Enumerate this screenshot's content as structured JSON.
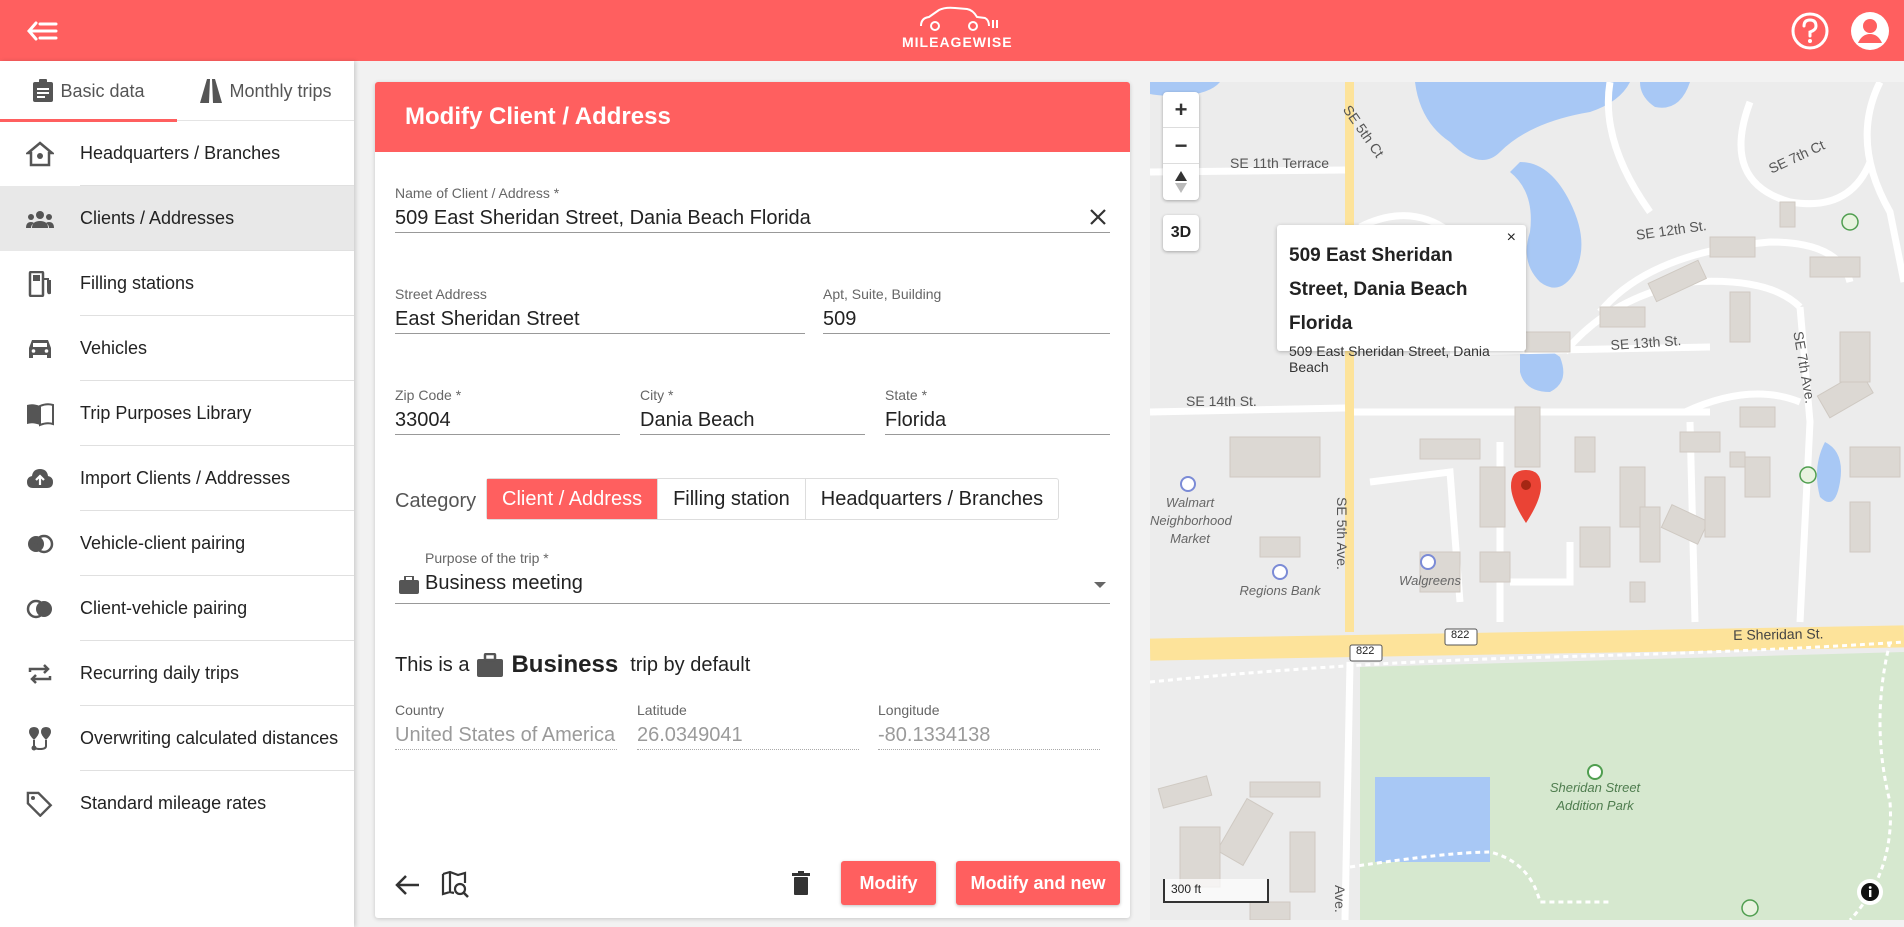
{
  "app": {
    "logo_text": "MILEAGEWISE"
  },
  "sidebar": {
    "tabs": [
      {
        "label": "Basic data",
        "icon": "clipboard-icon"
      },
      {
        "label": "Monthly trips",
        "icon": "road-icon"
      }
    ],
    "items": [
      {
        "label": "Headquarters / Branches",
        "icon": "home-pin-icon"
      },
      {
        "label": "Clients / Addresses",
        "icon": "people-icon"
      },
      {
        "label": "Filling stations",
        "icon": "fuel-pump-icon"
      },
      {
        "label": "Vehicles",
        "icon": "car-icon"
      },
      {
        "label": "Trip Purposes Library",
        "icon": "book-icon"
      },
      {
        "label": "Import Clients / Addresses",
        "icon": "cloud-upload-icon"
      },
      {
        "label": "Vehicle-client pairing",
        "icon": "pairing-icon"
      },
      {
        "label": "Client-vehicle pairing",
        "icon": "pairing-icon"
      },
      {
        "label": "Recurring daily trips",
        "icon": "repeat-icon"
      },
      {
        "label": "Overwriting calculated distances",
        "icon": "route-pins-icon"
      },
      {
        "label": "Standard mileage rates",
        "icon": "tag-icon"
      }
    ]
  },
  "form": {
    "title": "Modify Client / Address",
    "name": {
      "label": "Name of Client / Address *",
      "value": "509 East Sheridan Street, Dania Beach Florida"
    },
    "street": {
      "label": "Street Address",
      "value": "East Sheridan Street"
    },
    "apt": {
      "label": "Apt, Suite, Building",
      "value": "509"
    },
    "zip": {
      "label": "Zip Code *",
      "value": "33004"
    },
    "city": {
      "label": "City *",
      "value": "Dania Beach"
    },
    "state": {
      "label": "State *",
      "value": "Florida"
    },
    "category": {
      "label": "Category",
      "options": [
        "Client / Address",
        "Filling station",
        "Headquarters / Branches"
      ],
      "selected": "Client / Address"
    },
    "purpose": {
      "label": "Purpose of the trip *",
      "value": "Business meeting"
    },
    "default_trip": {
      "prefix": "This is a",
      "type": "Business",
      "suffix": "trip by default"
    },
    "country": {
      "label": "Country",
      "value": "United States of America"
    },
    "latitude": {
      "label": "Latitude",
      "value": "26.0349041"
    },
    "longitude": {
      "label": "Longitude",
      "value": "-80.1334138"
    },
    "buttons": {
      "modify": "Modify",
      "modify_new": "Modify and new"
    }
  },
  "map": {
    "controls": {
      "zoom_in": "+",
      "zoom_out": "−",
      "three_d": "3D"
    },
    "popup": {
      "title": "509 East Sheridan Street, Dania Beach Florida",
      "subtitle": "509 East Sheridan Street, Dania Beach",
      "close": "×"
    },
    "scale": "300 ft",
    "labels": {
      "se5thct": "SE 5th Ct",
      "se11th": "SE 11th Terrace",
      "se7thct": "SE 7th Ct",
      "se12th": "SE 12th St.",
      "se13th": "SE 13th St.",
      "se7thave": "SE 7th Ave.",
      "se14th": "SE 14th St.",
      "se5thave": "SE 5th Ave.",
      "esheridan": "E Sheridan St.",
      "r822a": "822",
      "r822b": "822",
      "ave": "Ave."
    },
    "pois": {
      "walmart": "Walmart Neighborhood Market",
      "regions": "Regions Bank",
      "walgreens": "Walgreens",
      "park": "Sheridan Street Addition Park"
    },
    "colors": {
      "water": "#a8c8f5",
      "road_major": "#fde39a",
      "park": "#d6e8cf"
    }
  }
}
